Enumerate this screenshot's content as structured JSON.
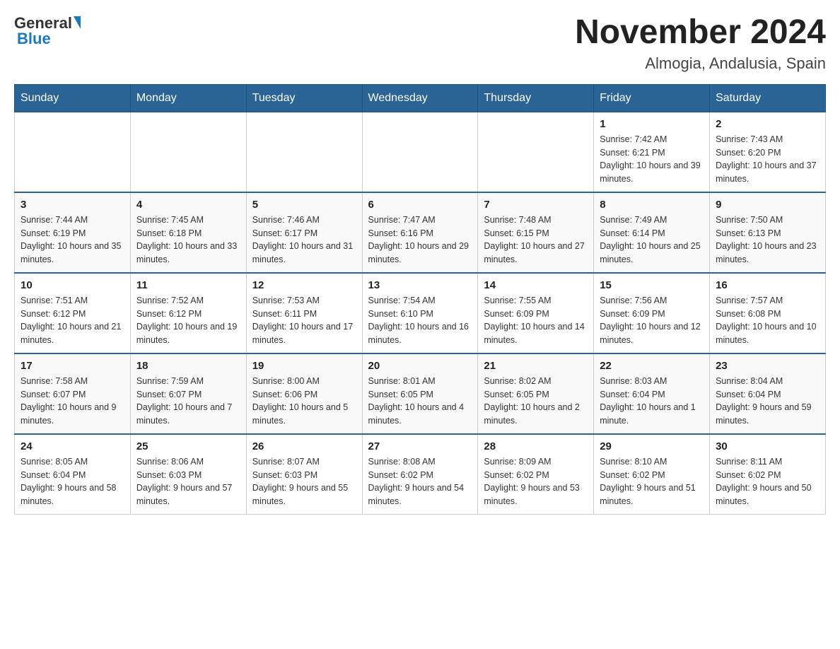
{
  "header": {
    "logo_general": "General",
    "logo_blue": "Blue",
    "month_title": "November 2024",
    "location": "Almogia, Andalusia, Spain"
  },
  "days_of_week": [
    "Sunday",
    "Monday",
    "Tuesday",
    "Wednesday",
    "Thursday",
    "Friday",
    "Saturday"
  ],
  "weeks": [
    [
      {
        "day": "",
        "sunrise": "",
        "sunset": "",
        "daylight": ""
      },
      {
        "day": "",
        "sunrise": "",
        "sunset": "",
        "daylight": ""
      },
      {
        "day": "",
        "sunrise": "",
        "sunset": "",
        "daylight": ""
      },
      {
        "day": "",
        "sunrise": "",
        "sunset": "",
        "daylight": ""
      },
      {
        "day": "",
        "sunrise": "",
        "sunset": "",
        "daylight": ""
      },
      {
        "day": "1",
        "sunrise": "Sunrise: 7:42 AM",
        "sunset": "Sunset: 6:21 PM",
        "daylight": "Daylight: 10 hours and 39 minutes."
      },
      {
        "day": "2",
        "sunrise": "Sunrise: 7:43 AM",
        "sunset": "Sunset: 6:20 PM",
        "daylight": "Daylight: 10 hours and 37 minutes."
      }
    ],
    [
      {
        "day": "3",
        "sunrise": "Sunrise: 7:44 AM",
        "sunset": "Sunset: 6:19 PM",
        "daylight": "Daylight: 10 hours and 35 minutes."
      },
      {
        "day": "4",
        "sunrise": "Sunrise: 7:45 AM",
        "sunset": "Sunset: 6:18 PM",
        "daylight": "Daylight: 10 hours and 33 minutes."
      },
      {
        "day": "5",
        "sunrise": "Sunrise: 7:46 AM",
        "sunset": "Sunset: 6:17 PM",
        "daylight": "Daylight: 10 hours and 31 minutes."
      },
      {
        "day": "6",
        "sunrise": "Sunrise: 7:47 AM",
        "sunset": "Sunset: 6:16 PM",
        "daylight": "Daylight: 10 hours and 29 minutes."
      },
      {
        "day": "7",
        "sunrise": "Sunrise: 7:48 AM",
        "sunset": "Sunset: 6:15 PM",
        "daylight": "Daylight: 10 hours and 27 minutes."
      },
      {
        "day": "8",
        "sunrise": "Sunrise: 7:49 AM",
        "sunset": "Sunset: 6:14 PM",
        "daylight": "Daylight: 10 hours and 25 minutes."
      },
      {
        "day": "9",
        "sunrise": "Sunrise: 7:50 AM",
        "sunset": "Sunset: 6:13 PM",
        "daylight": "Daylight: 10 hours and 23 minutes."
      }
    ],
    [
      {
        "day": "10",
        "sunrise": "Sunrise: 7:51 AM",
        "sunset": "Sunset: 6:12 PM",
        "daylight": "Daylight: 10 hours and 21 minutes."
      },
      {
        "day": "11",
        "sunrise": "Sunrise: 7:52 AM",
        "sunset": "Sunset: 6:12 PM",
        "daylight": "Daylight: 10 hours and 19 minutes."
      },
      {
        "day": "12",
        "sunrise": "Sunrise: 7:53 AM",
        "sunset": "Sunset: 6:11 PM",
        "daylight": "Daylight: 10 hours and 17 minutes."
      },
      {
        "day": "13",
        "sunrise": "Sunrise: 7:54 AM",
        "sunset": "Sunset: 6:10 PM",
        "daylight": "Daylight: 10 hours and 16 minutes."
      },
      {
        "day": "14",
        "sunrise": "Sunrise: 7:55 AM",
        "sunset": "Sunset: 6:09 PM",
        "daylight": "Daylight: 10 hours and 14 minutes."
      },
      {
        "day": "15",
        "sunrise": "Sunrise: 7:56 AM",
        "sunset": "Sunset: 6:09 PM",
        "daylight": "Daylight: 10 hours and 12 minutes."
      },
      {
        "day": "16",
        "sunrise": "Sunrise: 7:57 AM",
        "sunset": "Sunset: 6:08 PM",
        "daylight": "Daylight: 10 hours and 10 minutes."
      }
    ],
    [
      {
        "day": "17",
        "sunrise": "Sunrise: 7:58 AM",
        "sunset": "Sunset: 6:07 PM",
        "daylight": "Daylight: 10 hours and 9 minutes."
      },
      {
        "day": "18",
        "sunrise": "Sunrise: 7:59 AM",
        "sunset": "Sunset: 6:07 PM",
        "daylight": "Daylight: 10 hours and 7 minutes."
      },
      {
        "day": "19",
        "sunrise": "Sunrise: 8:00 AM",
        "sunset": "Sunset: 6:06 PM",
        "daylight": "Daylight: 10 hours and 5 minutes."
      },
      {
        "day": "20",
        "sunrise": "Sunrise: 8:01 AM",
        "sunset": "Sunset: 6:05 PM",
        "daylight": "Daylight: 10 hours and 4 minutes."
      },
      {
        "day": "21",
        "sunrise": "Sunrise: 8:02 AM",
        "sunset": "Sunset: 6:05 PM",
        "daylight": "Daylight: 10 hours and 2 minutes."
      },
      {
        "day": "22",
        "sunrise": "Sunrise: 8:03 AM",
        "sunset": "Sunset: 6:04 PM",
        "daylight": "Daylight: 10 hours and 1 minute."
      },
      {
        "day": "23",
        "sunrise": "Sunrise: 8:04 AM",
        "sunset": "Sunset: 6:04 PM",
        "daylight": "Daylight: 9 hours and 59 minutes."
      }
    ],
    [
      {
        "day": "24",
        "sunrise": "Sunrise: 8:05 AM",
        "sunset": "Sunset: 6:04 PM",
        "daylight": "Daylight: 9 hours and 58 minutes."
      },
      {
        "day": "25",
        "sunrise": "Sunrise: 8:06 AM",
        "sunset": "Sunset: 6:03 PM",
        "daylight": "Daylight: 9 hours and 57 minutes."
      },
      {
        "day": "26",
        "sunrise": "Sunrise: 8:07 AM",
        "sunset": "Sunset: 6:03 PM",
        "daylight": "Daylight: 9 hours and 55 minutes."
      },
      {
        "day": "27",
        "sunrise": "Sunrise: 8:08 AM",
        "sunset": "Sunset: 6:02 PM",
        "daylight": "Daylight: 9 hours and 54 minutes."
      },
      {
        "day": "28",
        "sunrise": "Sunrise: 8:09 AM",
        "sunset": "Sunset: 6:02 PM",
        "daylight": "Daylight: 9 hours and 53 minutes."
      },
      {
        "day": "29",
        "sunrise": "Sunrise: 8:10 AM",
        "sunset": "Sunset: 6:02 PM",
        "daylight": "Daylight: 9 hours and 51 minutes."
      },
      {
        "day": "30",
        "sunrise": "Sunrise: 8:11 AM",
        "sunset": "Sunset: 6:02 PM",
        "daylight": "Daylight: 9 hours and 50 minutes."
      }
    ]
  ]
}
